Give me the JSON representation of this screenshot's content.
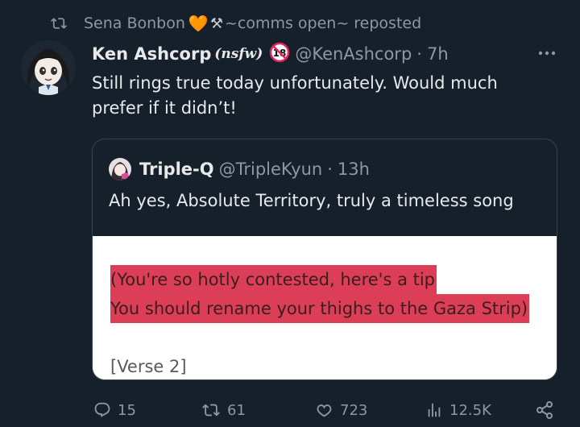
{
  "repost": {
    "user": "Sena Bonbon",
    "heart_emoji": "🧡",
    "tools_emoji": "⚒",
    "suffix": "~comms open~ reposted"
  },
  "tweet": {
    "author_name": "Ken Ashcorp",
    "author_tag": "(nsfw)",
    "badge": "18",
    "handle": "@KenAshcorp",
    "dot": "·",
    "time": "7h",
    "text": "Still rings true today unfortunately. Would much prefer if it didn’t!"
  },
  "quote": {
    "author_name": "Triple-Q",
    "handle": "@TripleKyun",
    "dot": "·",
    "time": "13h",
    "text": "Ah yes, Absolute Territory, truly a timeless song",
    "media": {
      "line1": "(You're so hotly contested, here's a tip",
      "line2": "You should rename your thighs to the Gaza Strip)",
      "line3": "[Verse 2]"
    }
  },
  "actions": {
    "replies": "15",
    "reposts": "61",
    "likes": "723",
    "views": "12.5K"
  },
  "colors": {
    "background": "#15202b",
    "muted": "#8b98a5",
    "highlight": "#dc3e57"
  },
  "icons": {
    "repost": "repost-icon",
    "more": "more-icon",
    "reply": "reply-icon",
    "like": "heart-icon",
    "views": "views-icon",
    "share": "share-icon"
  }
}
